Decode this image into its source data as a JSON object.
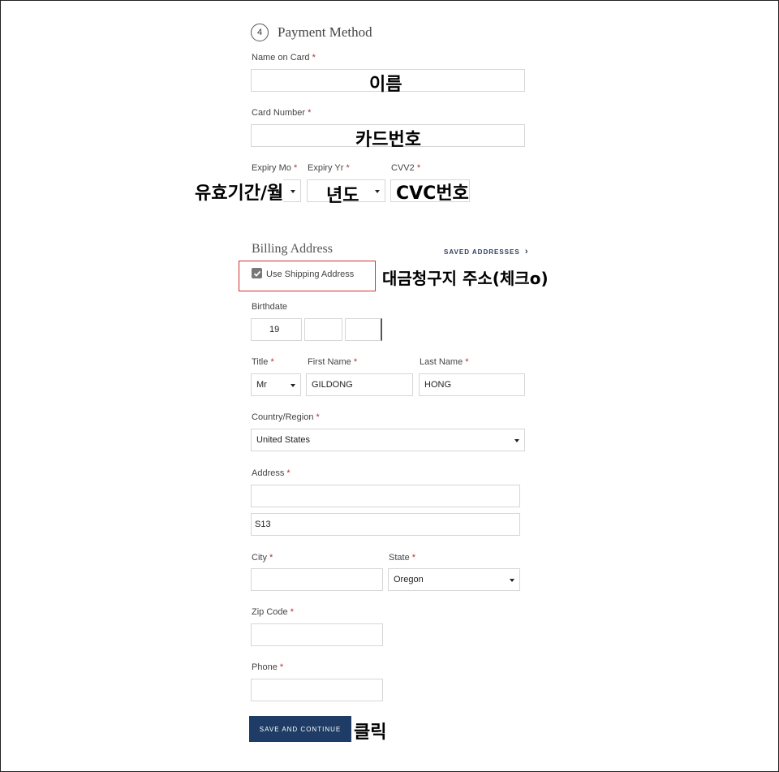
{
  "payment": {
    "step_number": "4",
    "section_title": "Payment Method",
    "name_on_card_label": "Name on Card",
    "card_number_label": "Card Number",
    "expiry_mo_label": "Expiry Mo",
    "expiry_yr_label": "Expiry Yr",
    "cvv2_label": "CVV2",
    "required_mark": "*"
  },
  "annotations": {
    "name": "이름",
    "card_number": "카드번호",
    "expiry_month": "유효기간/월",
    "expiry_year": "년도",
    "cvc": "CVC번호",
    "billing_same": "대금청구지 주소(체크o)",
    "click": "클릭"
  },
  "billing": {
    "section_title": "Billing Address",
    "saved_addresses_link": "SAVED ADDRESSES",
    "saved_addresses_chevron": "›",
    "use_shipping_label": "Use Shipping Address",
    "use_shipping_checked": true,
    "birthdate_label": "Birthdate",
    "birthdate_year_prefix": "19",
    "title_label": "Title",
    "title_value": "Mr",
    "first_name_label": "First Name",
    "first_name_value": "GILDONG",
    "last_name_label": "Last Name",
    "last_name_value": "HONG",
    "country_label": "Country/Region",
    "country_value": "United States",
    "address_label": "Address",
    "address_line2_value": "S13",
    "city_label": "City",
    "state_label": "State",
    "state_value": "Oregon",
    "zip_label": "Zip Code",
    "phone_label": "Phone"
  },
  "actions": {
    "save_continue": "SAVE AND CONTINUE"
  },
  "colors": {
    "button_bg": "#1e3c65",
    "required": "#b03030",
    "highlight": "#d0312d"
  }
}
